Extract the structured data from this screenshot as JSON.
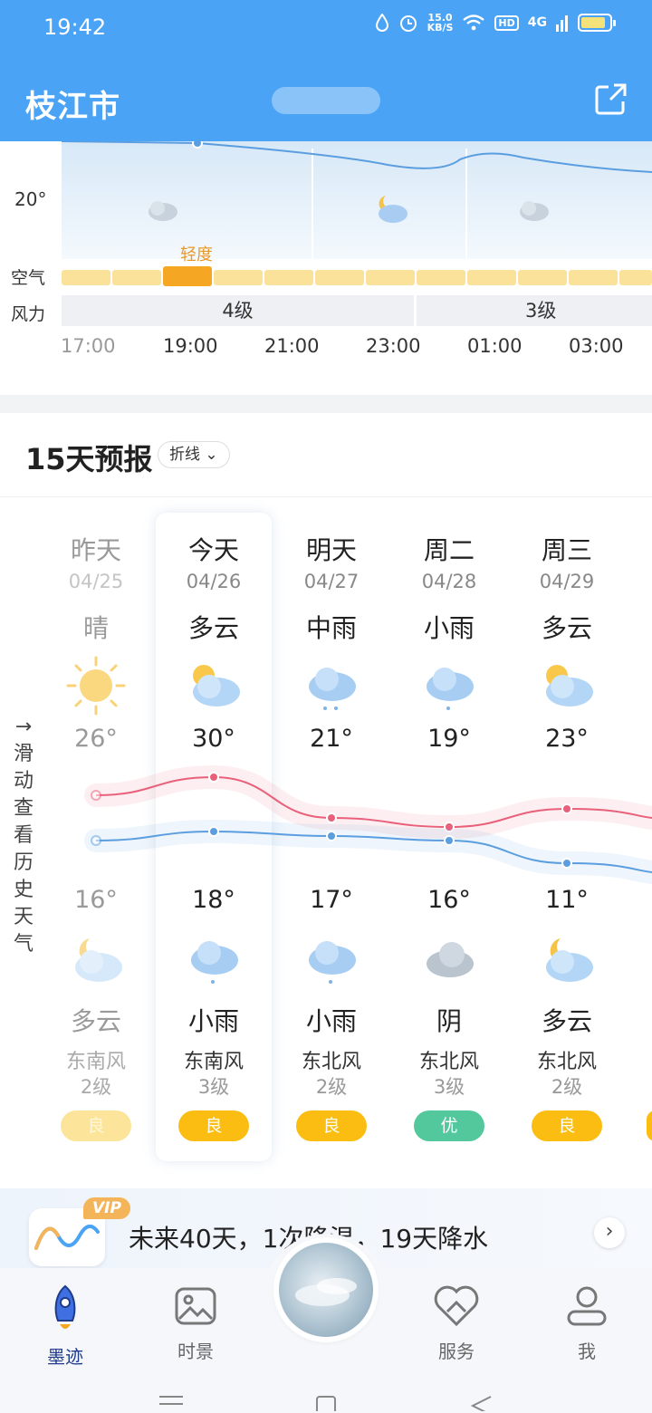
{
  "status_bar": {
    "time": "19:42",
    "speed_value": "15.0",
    "speed_unit": "KB/S",
    "hd": "HD",
    "network": "4G"
  },
  "header": {
    "city": "枝江市"
  },
  "hourly": {
    "temp_label": "20°",
    "air_label": "空气",
    "air_active_text": "轻度",
    "wind_label": "风力",
    "wind_segments": [
      "4级",
      "3级"
    ],
    "times": [
      "17:00",
      "19:00",
      "21:00",
      "23:00",
      "01:00",
      "03:00"
    ]
  },
  "forecast": {
    "title": "15天预报",
    "mode": "折线",
    "history_hint": [
      "→",
      "滑",
      "动",
      "查",
      "看",
      "历",
      "史",
      "天",
      "气"
    ],
    "days": [
      {
        "name": "昨天",
        "date": "04/25",
        "day_weather": "晴",
        "day_icon": "sun-icon",
        "high": "26°",
        "low": "16°",
        "night_icon": "moon-cloud-icon",
        "night_weather": "多云",
        "wind_dir": "东南风",
        "wind_level": "2级",
        "aqi": "良"
      },
      {
        "name": "今天",
        "date": "04/26",
        "day_weather": "多云",
        "day_icon": "sun-cloud-icon",
        "high": "30°",
        "low": "18°",
        "night_icon": "rain-cloud-icon",
        "night_weather": "小雨",
        "wind_dir": "东南风",
        "wind_level": "3级",
        "aqi": "良"
      },
      {
        "name": "明天",
        "date": "04/27",
        "day_weather": "中雨",
        "day_icon": "rain-cloud-icon",
        "high": "21°",
        "low": "17°",
        "night_icon": "rain-cloud-icon",
        "night_weather": "小雨",
        "wind_dir": "东北风",
        "wind_level": "2级",
        "aqi": "良"
      },
      {
        "name": "周二",
        "date": "04/28",
        "day_weather": "小雨",
        "day_icon": "rain-cloud-icon",
        "high": "19°",
        "low": "16°",
        "night_icon": "overcast-icon",
        "night_weather": "阴",
        "wind_dir": "东北风",
        "wind_level": "3级",
        "aqi": "优"
      },
      {
        "name": "周三",
        "date": "04/29",
        "day_weather": "多云",
        "day_icon": "sun-cloud-icon",
        "high": "23°",
        "low": "11°",
        "night_icon": "moon-cloud-icon",
        "night_weather": "多云",
        "wind_dir": "东北风",
        "wind_level": "2级",
        "aqi": "良"
      }
    ],
    "high_temps": [
      26,
      30,
      21,
      19,
      23
    ],
    "low_temps": [
      16,
      18,
      17,
      16,
      11
    ]
  },
  "vip": {
    "badge": "VIP",
    "text": "未来40天，1次降温，19天降水"
  },
  "nav": {
    "items": [
      "墨迹",
      "时景",
      "服务",
      "我"
    ]
  },
  "colors": {
    "header": "#4ba3f5",
    "aqi_good": "#fbbd11",
    "aqi_excellent": "#53c89d",
    "high_line": "#e8607a",
    "low_line": "#5a9ee0"
  }
}
